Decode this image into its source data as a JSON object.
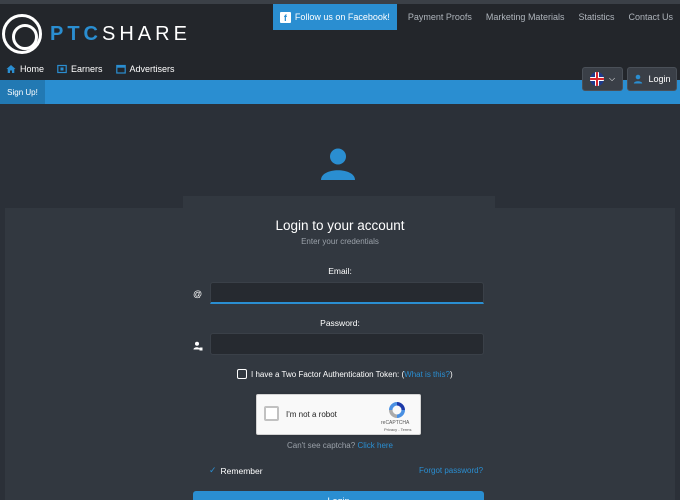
{
  "brand": {
    "part1": "PTC",
    "part2": "SHARE"
  },
  "topnav": {
    "facebook_label": "Follow us on Facebook!",
    "links": [
      "Payment Proofs",
      "Marketing Materials",
      "Statistics",
      "Contact Us"
    ]
  },
  "subnav": {
    "items": [
      "Home",
      "Earners",
      "Advertisers"
    ]
  },
  "actions": {
    "login_label": "Login",
    "signup_label": "Sign Up!"
  },
  "login": {
    "title": "Login to your account",
    "subtitle": "Enter your credentials",
    "email_label": "Email:",
    "email_value": "",
    "password_label": "Password:",
    "password_value": "",
    "tfa_text": "I have a Two Factor Authentication Token: (",
    "tfa_link": "What is this?",
    "tfa_close": ")",
    "captcha_text": "I'm not a robot",
    "captcha_brand": "reCAPTCHA",
    "captcha_terms": "Privacy - Terms",
    "cant_see_text": "Can't see captcha? ",
    "cant_see_link": "Click here",
    "remember_label": "Remember",
    "forgot_label": "Forgot password?",
    "submit_label": "Login"
  },
  "colors": {
    "accent": "#2a8ed1",
    "background": "#2b3038",
    "header": "#23262b",
    "card": "#323840"
  }
}
